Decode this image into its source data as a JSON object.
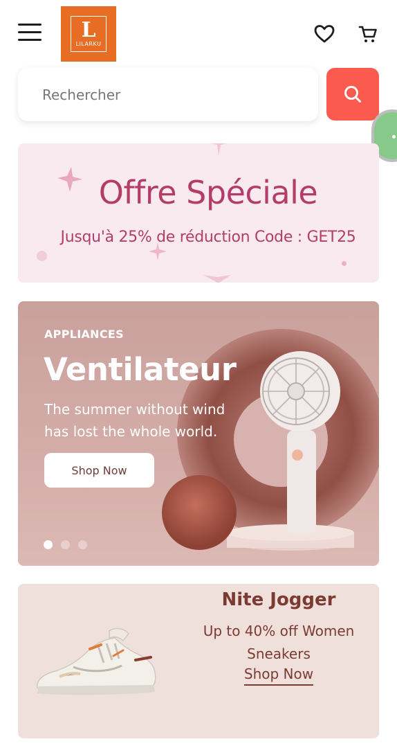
{
  "header": {
    "logo_text": "LILARKU",
    "menu_icon": "hamburger-icon",
    "wishlist_icon": "heart-icon",
    "cart_icon": "cart-icon"
  },
  "search": {
    "placeholder": "Rechercher",
    "value": "",
    "button_icon": "search-icon",
    "button_color": "#fb5a4e"
  },
  "offer_banner": {
    "title": "Offre Spéciale",
    "subtitle": "Jusqu'à 25% de réduction Code : GET25",
    "text_color": "#b33d68",
    "background": "#f8eaee"
  },
  "hero": {
    "kicker": "APPLIANCES",
    "title": "Ventilateur",
    "description": "The summer without wind has lost the whole world.",
    "cta_label": "Shop Now",
    "slides_total": 3,
    "active_slide": 1
  },
  "promo_card": {
    "title": "Nite Jogger",
    "subtitle": "Up to 40% off Women Sneakers",
    "link_label": "Shop Now",
    "text_color": "#7b3b33"
  },
  "floating_widget": {
    "icon": "more-dots-icon",
    "color": "#87c98b"
  }
}
